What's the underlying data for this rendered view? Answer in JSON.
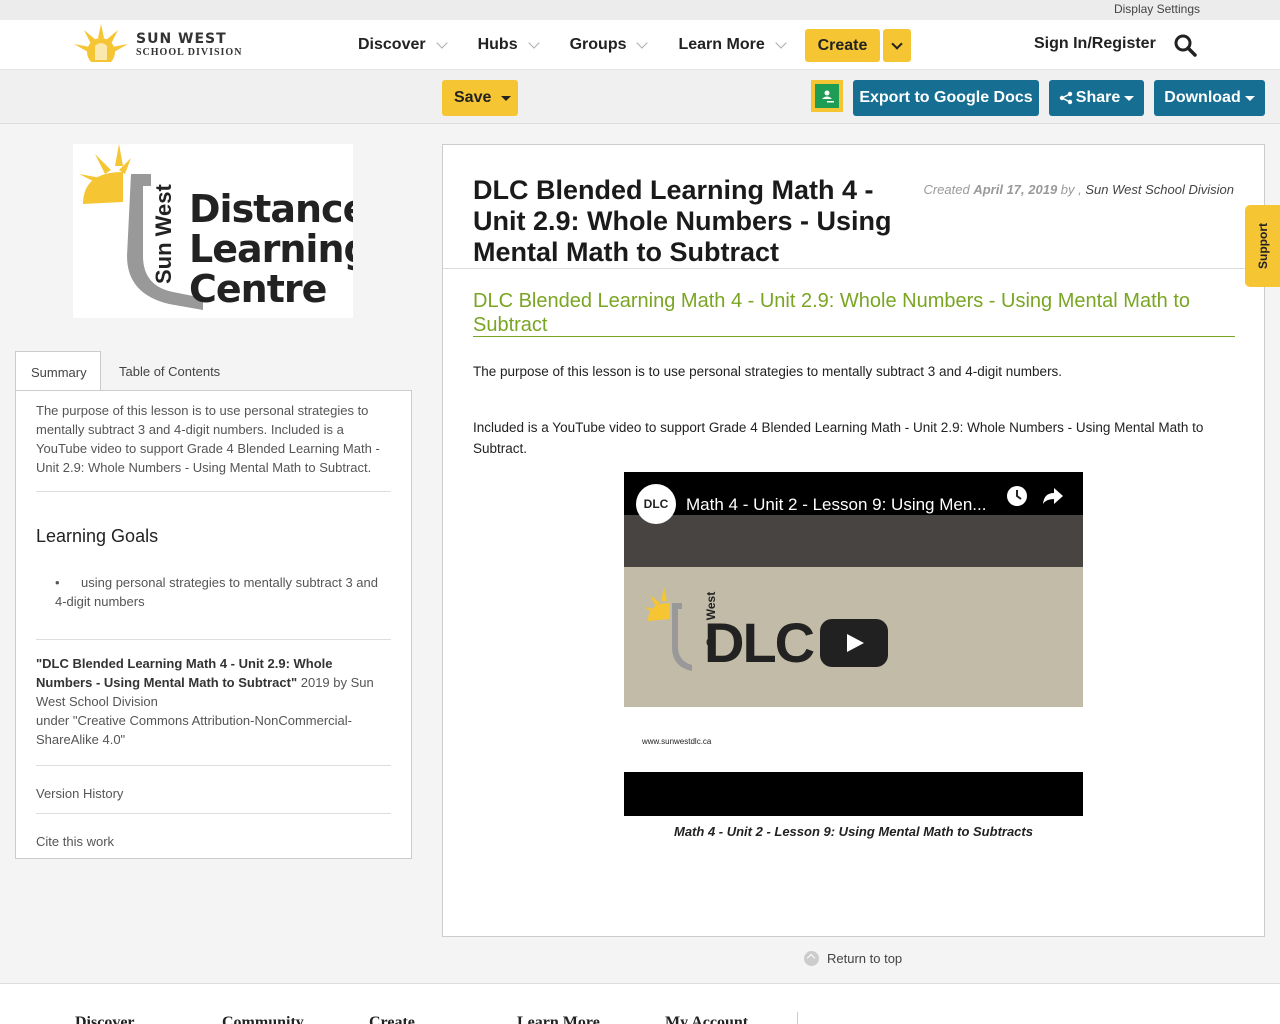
{
  "util": {
    "display_settings": "Display Settings"
  },
  "header": {
    "brand_line1": "SUN WEST",
    "brand_line2": "SCHOOL DIVISION",
    "nav": [
      "Discover",
      "Hubs",
      "Groups",
      "Learn More"
    ],
    "create": "Create",
    "signin": "Sign In/Register",
    "search_icon": "search-icon"
  },
  "toolbar": {
    "save": "Save",
    "export": "Export to Google Docs",
    "share": "Share",
    "download": "Download",
    "classroom_icon": "google-classroom-icon"
  },
  "sidebar": {
    "logo_sun_west": "Sun West",
    "logo_line1": "Distance",
    "logo_line2": "Learning",
    "logo_line3": "Centre",
    "tabs": [
      "Summary",
      "Table of Contents"
    ],
    "summary": "The purpose of this lesson is to use personal strategies to mentally subtract 3 and 4-digit numbers. Included is a YouTube video to support Grade 4 Blended Learning Math - Unit 2.9: Whole Numbers - Using Mental Math to Subtract.",
    "goals_heading": "Learning Goals",
    "goals": [
      "using personal strategies to mentally subtract 3 and 4-digit numbers"
    ],
    "attribution_title": "\"DLC Blended Learning Math 4 - Unit 2.9: Whole Numbers - Using Mental Math to Subtract\"",
    "attribution_by": " 2019 by Sun West School Division",
    "attribution_license": "under \"Creative Commons Attribution-NonCommercial-ShareAlike 4.0\"",
    "version_history": "Version History",
    "cite": "Cite this work"
  },
  "main": {
    "title": "DLC Blended Learning Math 4 - Unit 2.9: Whole Numbers - Using Mental Math to Subtract",
    "created_label": "Created",
    "created_date": "April 17, 2019",
    "by_label": "by ,",
    "author": "Sun West School Division",
    "subtitle": "DLC Blended Learning Math 4 - Unit 2.9: Whole Numbers - Using Mental Math to Subtract",
    "para1": "The purpose of this lesson is to use personal strategies to mentally subtract 3 and 4-digit numbers.",
    "para2": "Included is a YouTube video to support Grade 4 Blended Learning Math - Unit 2.9: Whole Numbers - Using Mental Math to Subtract.",
    "video_title": "Math 4 - Unit 2 - Lesson 9: Using Men...",
    "video_channel": "DLC",
    "video_url": "www.sunwestdlc.ca",
    "video_logo": "DLC",
    "video_logo_side": "Sun West",
    "caption": "Math 4 - Unit 2 - Lesson 9: Using Mental Math to Subtracts"
  },
  "support": "Support",
  "return_top": "Return to top",
  "footer": [
    "Discover",
    "Community",
    "Create",
    "Learn More",
    "My Account"
  ],
  "colors": {
    "accent": "#f5c533",
    "button": "#166f93",
    "subtitle": "#7aa523"
  }
}
